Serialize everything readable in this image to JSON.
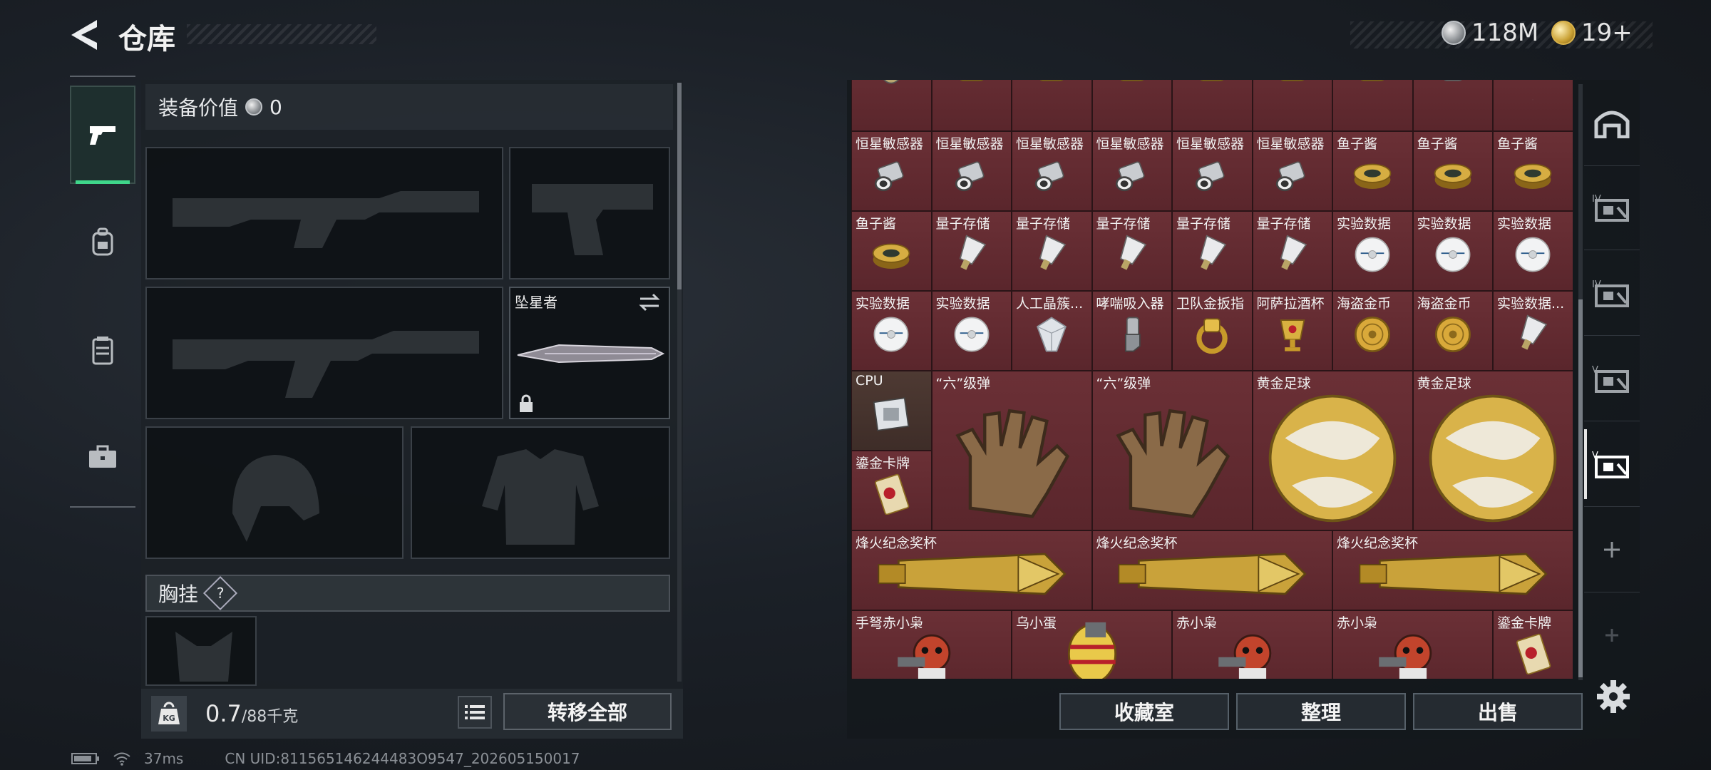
{
  "header": {
    "title": "仓库",
    "currency_1": "118M",
    "currency_2": "19+"
  },
  "rail": {
    "items": [
      "weapon",
      "backpack",
      "vest",
      "case"
    ]
  },
  "equip": {
    "value_label": "装备价值",
    "value": "0",
    "melee_label": "坠星者",
    "rig_label": "胸挂",
    "rig_help": "?",
    "weight_current": "0.7",
    "weight_max": "/88千克",
    "weight_icon_text": "KG",
    "transfer_all": "转移全部"
  },
  "grid": {
    "cells": [
      {
        "label": "",
        "icon": "compass"
      },
      {
        "label": "",
        "icon": "gold-item"
      },
      {
        "label": "",
        "icon": "gold-item"
      },
      {
        "label": "",
        "icon": "gold-item"
      },
      {
        "label": "",
        "icon": "gold-item"
      },
      {
        "label": "",
        "icon": "gold-item"
      },
      {
        "label": "",
        "icon": "gold-item"
      },
      {
        "label": "",
        "icon": "silver-item"
      },
      {
        "label": "恒星敏感器",
        "icon": "sensor"
      },
      {
        "label": "恒星敏感器",
        "icon": "sensor"
      },
      {
        "label": "恒星敏感器",
        "icon": "sensor"
      },
      {
        "label": "恒星敏感器",
        "icon": "sensor"
      },
      {
        "label": "恒星敏感器",
        "icon": "sensor"
      },
      {
        "label": "恒星敏感器",
        "icon": "sensor"
      },
      {
        "label": "鱼子酱",
        "icon": "caviar"
      },
      {
        "label": "鱼子酱",
        "icon": "caviar"
      },
      {
        "label": "鱼子酱",
        "icon": "caviar"
      },
      {
        "label": "鱼子酱",
        "icon": "caviar"
      },
      {
        "label": "量子存储",
        "icon": "usb"
      },
      {
        "label": "量子存储",
        "icon": "usb"
      },
      {
        "label": "量子存储",
        "icon": "usb"
      },
      {
        "label": "量子存储",
        "icon": "usb"
      },
      {
        "label": "量子存储",
        "icon": "usb"
      },
      {
        "label": "实验数据",
        "icon": "disc"
      },
      {
        "label": "实验数据",
        "icon": "disc"
      },
      {
        "label": "实验数据",
        "icon": "disc"
      },
      {
        "label": "实验数据",
        "icon": "disc"
      },
      {
        "label": "实验数据",
        "icon": "disc"
      },
      {
        "label": "人工晶簇...",
        "icon": "crystal"
      },
      {
        "label": "哮喘吸入器",
        "icon": "inhaler"
      },
      {
        "label": "卫队金扳指",
        "icon": "ring"
      },
      {
        "label": "阿萨拉酒杯",
        "icon": "cup"
      },
      {
        "label": "海盗金币",
        "icon": "coin"
      },
      {
        "label": "海盗金币",
        "icon": "coin"
      },
      {
        "label": "实验数据...",
        "icon": "usb"
      }
    ],
    "cpu_label": "CPU",
    "card_label": "鎏金卡牌",
    "glove_label": "“六”级弹",
    "ball_label": "黄金足球",
    "trophy_label": "烽火纪念奖杯",
    "row_last": [
      "手弩赤小枭",
      "乌小蛋",
      "赤小枭",
      "赤小枭",
      "鎏金卡牌"
    ]
  },
  "warehouse": {
    "btn_collection": "收藏室",
    "btn_sort": "整理",
    "btn_sell": "出售"
  },
  "side_tabs": [
    "main-tab",
    "expansion-1",
    "expansion-2",
    "expansion-3",
    "expansion-4",
    "add",
    "add-disabled"
  ],
  "status": {
    "ping": "37ms",
    "uid": "CN UID:811565146244483O9547_202605150017"
  },
  "colors": {
    "accent": "#3fd68a",
    "cell": "#6b3036"
  }
}
